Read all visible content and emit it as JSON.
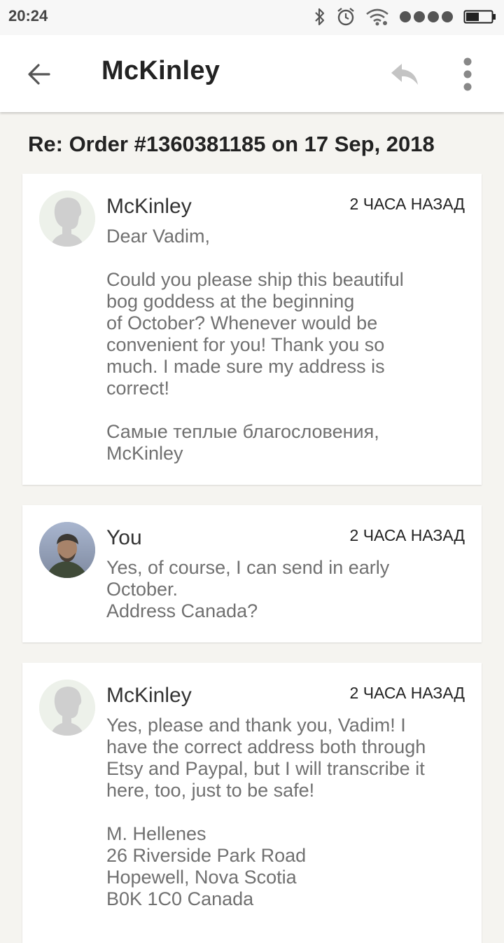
{
  "status_bar": {
    "time": "20:24"
  },
  "header": {
    "title": "McKinley"
  },
  "subject": "Re: Order #1360381185 on 17 Sep, 2018",
  "messages": [
    {
      "sender": "McKinley",
      "time": "2 ЧАСА НАЗАД",
      "avatar": "default-person-icon",
      "body": "Dear Vadim,\n\nCould you please ship this beautiful\nbog goddess at the beginning\nof October? Whenever would be\nconvenient for you! Thank you so\nmuch. I made sure my address is\ncorrect!\n\nСамые теплые благословения,\nMcKinley"
    },
    {
      "sender": "You",
      "time": "2 ЧАСА НАЗАД",
      "avatar": "user-photo",
      "body": "Yes, of course, I can send in early\nOctober.\nAddress Canada?"
    },
    {
      "sender": "McKinley",
      "time": "2 ЧАСА НАЗАД",
      "avatar": "default-person-icon",
      "body": "Yes, please and thank you, Vadim! I\nhave the correct address both through\nEtsy and Paypal, but I will transcribe it\nhere, too, just to be safe!\n\nM. Hellenes\n26 Riverside Park Road\nHopewell, Nova Scotia\nB0K 1C0 Canada"
    }
  ],
  "colors": {
    "background": "#f5f4f0",
    "card": "#ffffff",
    "body_text": "#707070"
  }
}
